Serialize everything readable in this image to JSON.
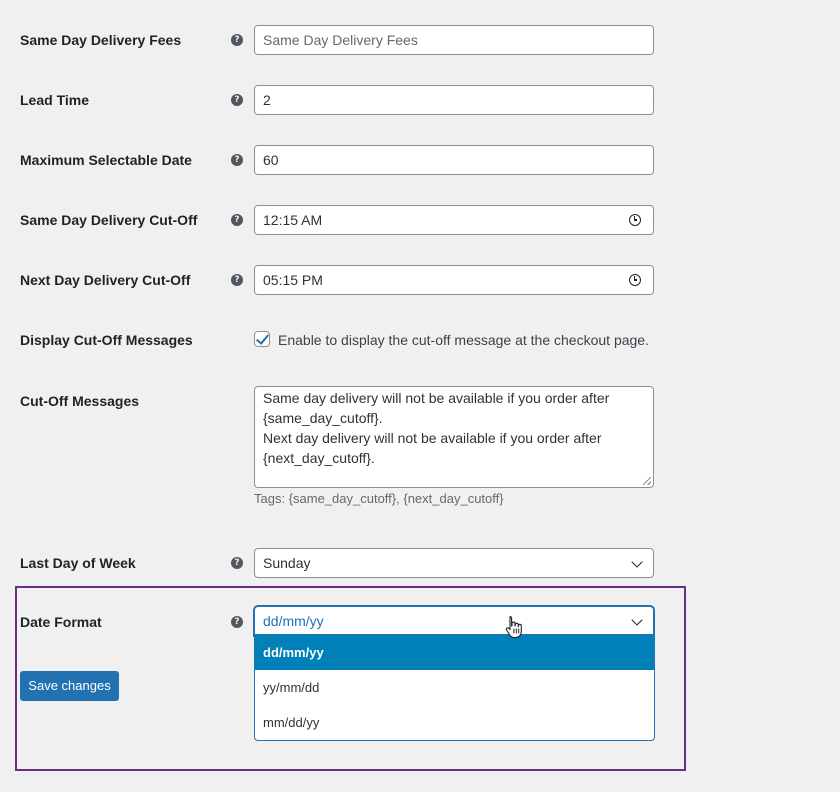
{
  "fields": {
    "fees": {
      "label": "Same Day Delivery Fees",
      "placeholder": "Same Day Delivery Fees"
    },
    "lead_time": {
      "label": "Lead Time",
      "value": "2"
    },
    "max_date": {
      "label": "Maximum Selectable Date",
      "value": "60"
    },
    "same_day_cutoff": {
      "label": "Same Day Delivery Cut-Off",
      "value": "12:15 AM"
    },
    "next_day_cutoff": {
      "label": "Next Day Delivery Cut-Off",
      "value": "05:15 PM"
    },
    "display_cutoff": {
      "label": "Display Cut-Off Messages",
      "checked": true,
      "checkbox_text": "Enable to display the cut-off message at the checkout page."
    },
    "cutoff_messages": {
      "label": "Cut-Off Messages",
      "lines": [
        "Same day delivery will not be available if you order after",
        "{same_day_cutoff}.",
        "Next day delivery will not be available if you order after",
        "{next_day_cutoff}."
      ],
      "tags": "Tags: {same_day_cutoff}, {next_day_cutoff}"
    },
    "last_day": {
      "label": "Last Day of Week",
      "value": "Sunday"
    },
    "date_format": {
      "label": "Date Format",
      "value": "dd/mm/yy",
      "options": [
        "dd/mm/yy",
        "yy/mm/dd",
        "mm/dd/yy"
      ],
      "selected_index": 0
    }
  },
  "help_glyph": "?",
  "save_button": "Save changes",
  "icons": {
    "help": "help-circle-icon",
    "time": "clock-icon",
    "select": "chevron-down-icon",
    "cursor": "hand-pointer-icon"
  },
  "colors": {
    "accent": "#2271b1",
    "option_highlight": "#0080b8",
    "highlight_box": "#6b2d8c",
    "background": "#f0f0f1"
  }
}
